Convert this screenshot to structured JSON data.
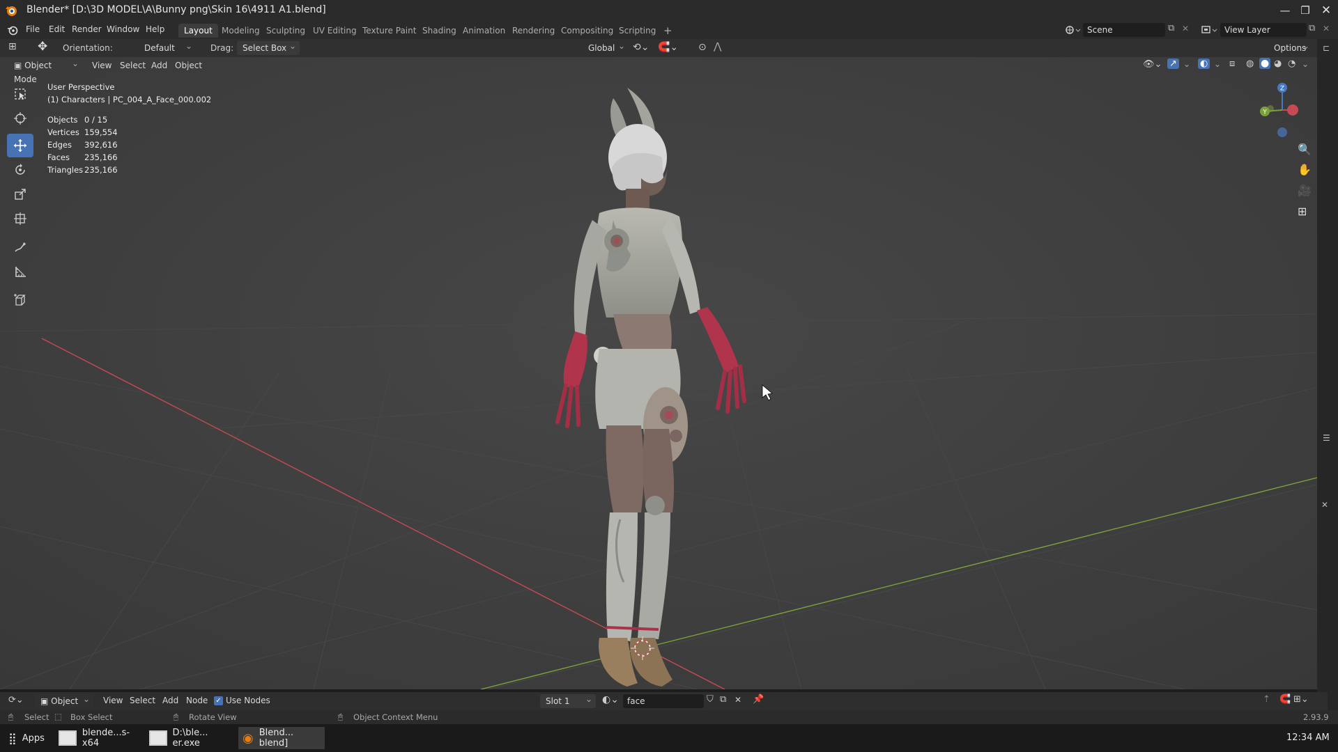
{
  "window": {
    "title": "Blender* [D:\\3D MODEL\\A\\Bunny png\\Skin 16\\4911 A1.blend]",
    "minimize_icon": "minimize-icon",
    "maximize_icon": "restore-icon",
    "close_icon": "close-icon"
  },
  "menubar": {
    "items": [
      "File",
      "Edit",
      "Render",
      "Window",
      "Help"
    ],
    "workspaces": [
      "Layout",
      "Modeling",
      "Sculpting",
      "UV Editing",
      "Texture Paint",
      "Shading",
      "Animation",
      "Rendering",
      "Compositing",
      "Scripting"
    ],
    "active_workspace": "Layout",
    "add_tab": "+",
    "scene_label": "Scene",
    "view_layer_label": "View Layer"
  },
  "toolheader": {
    "orientation_label": "Orientation:",
    "orientation_value": "Default",
    "drag_label": "Drag:",
    "drag_value": "Select Box",
    "transform_orientation": "Global",
    "options_label": "Options"
  },
  "viewheader": {
    "mode": "Object Mode",
    "menus": [
      "View",
      "Select",
      "Add",
      "Object"
    ]
  },
  "viewport": {
    "perspective_label": "User Perspective",
    "collection_label": "(1) Characters | PC_004_A_Face_000.002",
    "stats": [
      {
        "label": "Objects",
        "value": "0 / 15"
      },
      {
        "label": "Vertices",
        "value": "159,554"
      },
      {
        "label": "Edges",
        "value": "392,616"
      },
      {
        "label": "Faces",
        "value": "235,166"
      },
      {
        "label": "Triangles",
        "value": "235,166"
      }
    ],
    "gizmo_axes": {
      "x": "X",
      "y": "Y",
      "z": "Z"
    },
    "colors": {
      "x_axis": "#c44a55",
      "y_axis": "#7da13a",
      "z_axis": "#4a78c0",
      "active_tool": "#4772b3"
    }
  },
  "bottomheader": {
    "editor_type": "Object",
    "menus": [
      "View",
      "Select",
      "Add",
      "Node"
    ],
    "use_nodes_label": "Use Nodes",
    "use_nodes_checked": true,
    "slot": "Slot 1",
    "material_name": "face"
  },
  "statusbar": {
    "select": "Select",
    "box_select": "Box Select",
    "rotate_view": "Rotate View",
    "context_menu": "Object Context Menu",
    "version": "2.93.9"
  },
  "taskbar": {
    "apps_label": "Apps",
    "items": [
      "blende...s-x64",
      "D:\\ble... er.exe",
      "Blend... blend]"
    ],
    "time": "12:34 AM"
  }
}
